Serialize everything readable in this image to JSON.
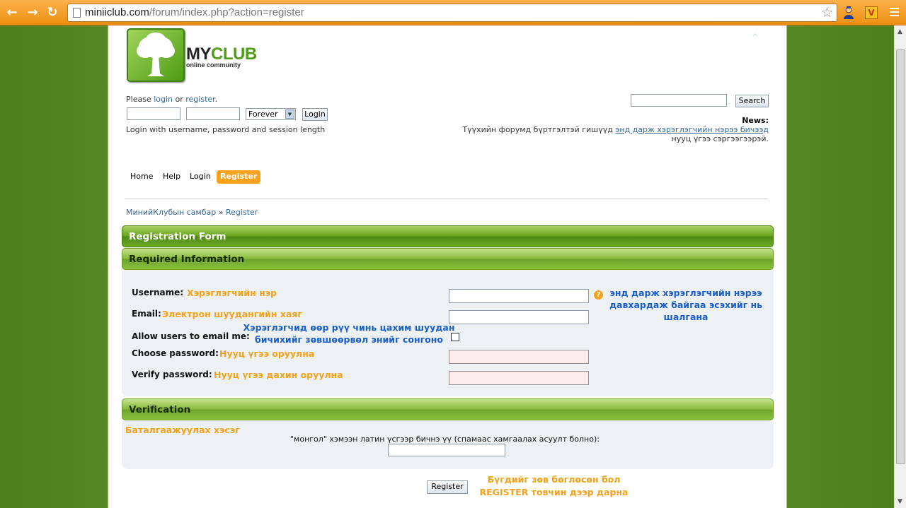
{
  "browser": {
    "url_domain": "miniiclub.com",
    "url_path": "/forum/index.php?action=register",
    "ext_badge": "V"
  },
  "logo": {
    "name_part1": "MY",
    "name_part2": "CLUB",
    "tagline": "online community"
  },
  "login": {
    "prompt_start": "Please ",
    "login_link": "login",
    "or": " or ",
    "register_link": "register",
    "end": ".",
    "session_option": "Forever",
    "login_button": "Login",
    "note": "Login with username, password and session length"
  },
  "search": {
    "button": "Search"
  },
  "news": {
    "title": "News:",
    "text_before": "Түүхийн форумд бүртгэлтэй гишүүд ",
    "link": "энд дарж хэрэглэгчийн нэрээ бичээд",
    "text_after": "нууц үгээ сэргээгээрэй."
  },
  "menu": [
    "Home",
    "Help",
    "Login",
    "Register"
  ],
  "breadcrumb": {
    "home": "МинийКлубын самбар",
    "sep": "»",
    "current": "Register"
  },
  "form": {
    "title": "Registration Form",
    "required_title": "Required Information",
    "username_label": "Username:",
    "username_note": "Хэрэглэгчийн нэр",
    "email_label": "Email:",
    "email_note": "Электрон шуудангийн хаяг",
    "allow_email_label": "Allow users to email me:",
    "allow_email_note_line1": "Хэрэглэгчид өөр рүү чинь цахим шуудан",
    "allow_email_note_line2": "бичихийг зөвшөөрвөл энийг сонгоно",
    "password_label": "Choose password:",
    "password_note": "Нууц үгээ оруулна",
    "verify_password_label": "Verify password:",
    "verify_password_note": "Нууц үгээ дахин оруулна",
    "help_icon": "?",
    "username_check_line1": "энд дарж хэрэглэгчийн нэрээ",
    "username_check_line2": "давхардаж байгаа эсэхийг нь",
    "username_check_line3": "шалгана"
  },
  "verification": {
    "title": "Verification",
    "section_note": "Баталгаажуулах хэсэг",
    "question": "\"монгол\" хэмээн латин үсгээр бичнэ үү (спамаас хамгаалах асуулт болно):"
  },
  "submit": {
    "button": "Register",
    "note_line1": "Бүгдийг зөв бөглөсөн бол",
    "note_line2": "REGISTER товчин дээр дарна"
  },
  "colors": {
    "accent": "#f7a21a",
    "green": "#4f9c16",
    "link": "#346699",
    "note_blue": "#1a5fc9",
    "note_orange": "#f5a21a"
  }
}
